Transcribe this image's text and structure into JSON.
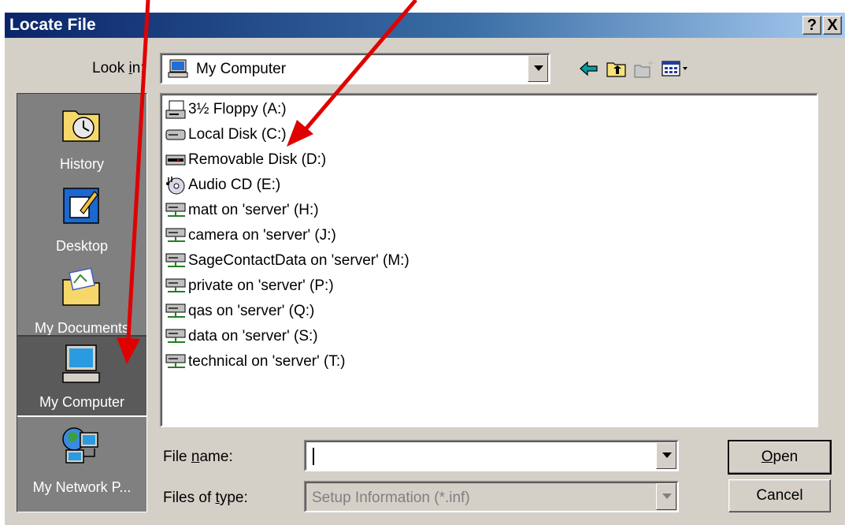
{
  "window": {
    "title": "Locate File",
    "help_label": "?",
    "close_label": "X"
  },
  "lookin": {
    "label_pre": "Look ",
    "label_key": "i",
    "label_post": "n:",
    "value": "My Computer"
  },
  "toolbar": {
    "icons": [
      "back-icon",
      "up-folder-icon",
      "new-folder-icon",
      "view-menu-icon"
    ]
  },
  "places": [
    {
      "label": "History",
      "icon": "history-icon"
    },
    {
      "label": "Desktop",
      "icon": "desktop-icon"
    },
    {
      "label": "My Documents",
      "icon": "my-documents-icon"
    },
    {
      "label": "My Computer",
      "icon": "my-computer-icon",
      "active": true
    },
    {
      "label": "My Network P...",
      "icon": "network-places-icon"
    }
  ],
  "files": [
    {
      "name": "3½ Floppy (A:)",
      "icon": "floppy-drive-icon"
    },
    {
      "name": "Local Disk (C:)",
      "icon": "hard-disk-icon"
    },
    {
      "name": "Removable Disk (D:)",
      "icon": "removable-disk-icon"
    },
    {
      "name": "Audio CD (E:)",
      "icon": "audio-cd-icon"
    },
    {
      "name": "matt on 'server' (H:)",
      "icon": "network-drive-icon"
    },
    {
      "name": "camera on 'server' (J:)",
      "icon": "network-drive-icon"
    },
    {
      "name": "SageContactData on 'server' (M:)",
      "icon": "network-drive-icon"
    },
    {
      "name": "private on 'server' (P:)",
      "icon": "network-drive-icon"
    },
    {
      "name": "qas on 'server' (Q:)",
      "icon": "network-drive-icon"
    },
    {
      "name": "data on 'server' (S:)",
      "icon": "network-drive-icon"
    },
    {
      "name": "technical on 'server' (T:)",
      "icon": "network-drive-icon"
    }
  ],
  "filename": {
    "label_pre": "File ",
    "label_key": "n",
    "label_post": "ame:",
    "value": ""
  },
  "filetype": {
    "label_pre": "Files of ",
    "label_key": "t",
    "label_post": "ype:",
    "value": "Setup Information (*.inf)"
  },
  "buttons": {
    "open_key": "O",
    "open_rest": "pen",
    "cancel": "Cancel"
  },
  "annotation_color": "#e00000"
}
